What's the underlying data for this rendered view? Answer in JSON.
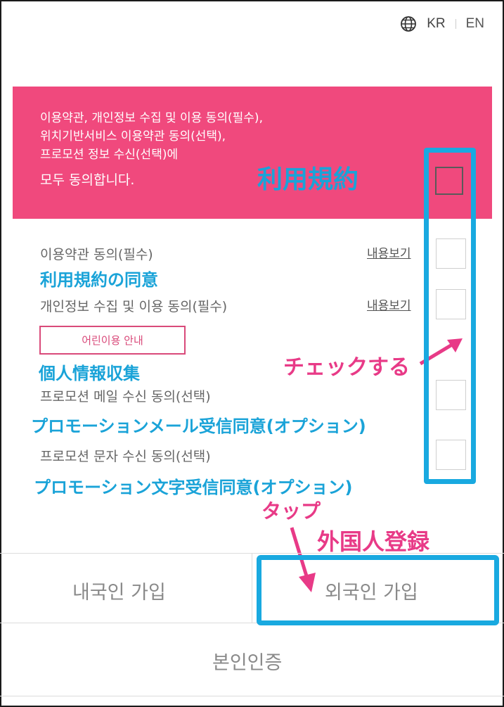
{
  "header": {
    "globe_icon": "globe-icon",
    "lang_kr": "KR",
    "lang_en": "EN"
  },
  "banner": {
    "line1": "이용약관, 개인정보 수집 및 이용 동의(필수),",
    "line2": "위치기반서비스 이용약관 동의(선택),",
    "line3": "프로모션 정보 수신(선택)에",
    "line4": "모두 동의합니다.",
    "annotation": "利用規約",
    "background_color": "#f0497d"
  },
  "items": [
    {
      "label": "이용약관 동의(필수)",
      "link": "내용보기",
      "annotation": "利用規約の同意"
    },
    {
      "label": "개인정보 수집 및 이용 동의(필수)",
      "link": "내용보기",
      "annotation": "個人情報収集"
    },
    {
      "label": "프로모션 메일 수신 동의(선택)",
      "annotation": "プロモーションメール受信同意(オプション)"
    },
    {
      "label": "프로모션 문자 수신 동의(선택)",
      "annotation": "プロモーション文字受信同意(オプション)"
    }
  ],
  "kids_button": "어린이용 안내",
  "annotations": {
    "check": "チェックする",
    "tap": "タップ",
    "foreign_register": "外国人登録",
    "highlight_color": "#19a9e0",
    "pink_color": "#e83a87"
  },
  "buttons": {
    "domestic": "내국인 가입",
    "foreign": "외국인 가입",
    "verify": "본인인증"
  }
}
